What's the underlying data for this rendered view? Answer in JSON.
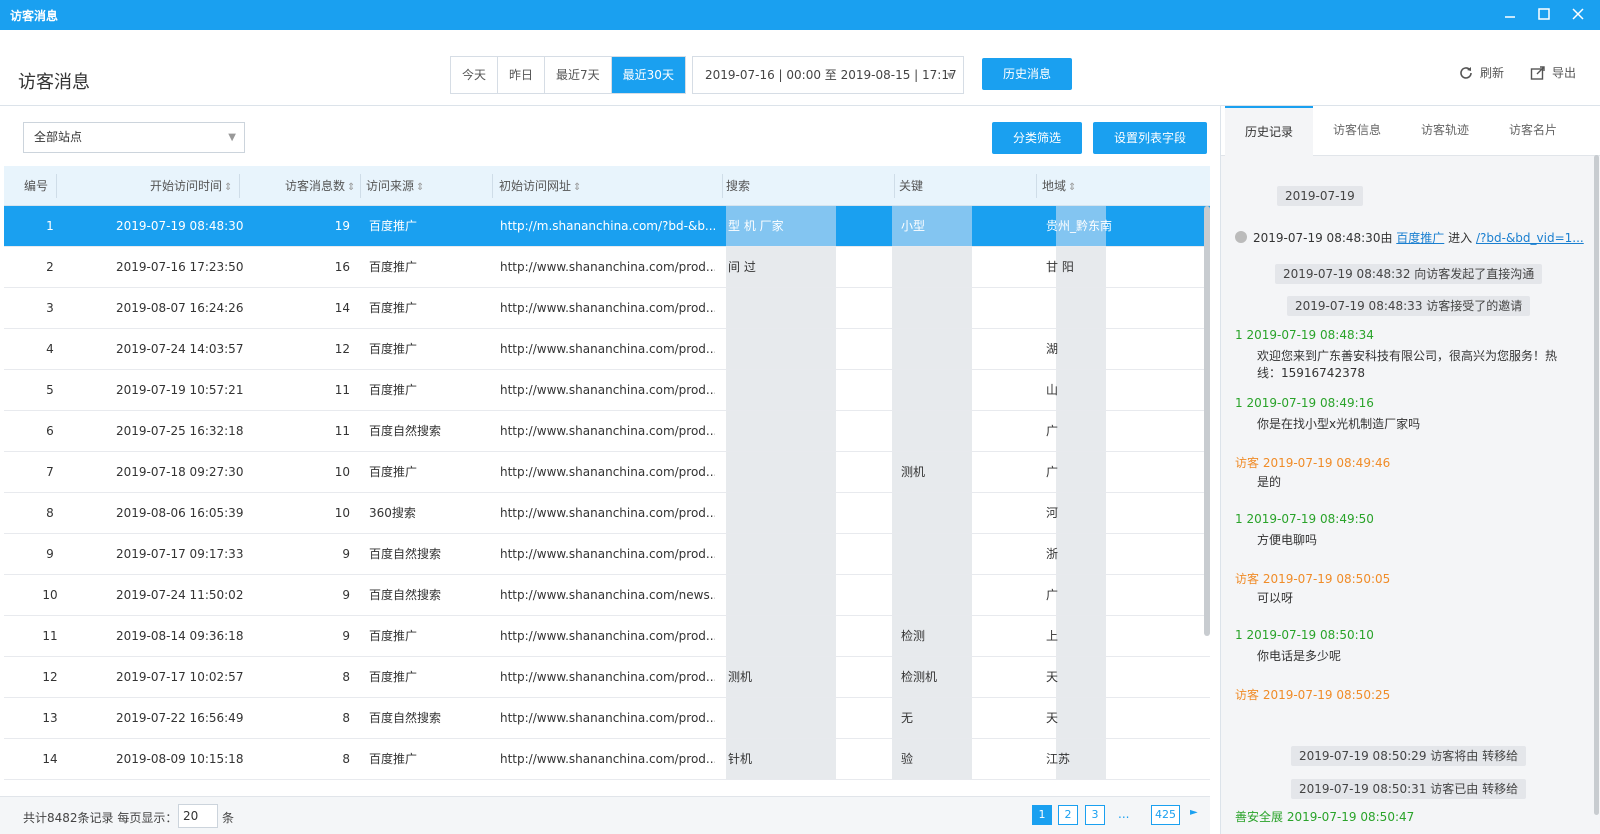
{
  "window": {
    "title": "访客消息"
  },
  "header": {
    "page_title": "访客消息",
    "range_tabs": [
      "今天",
      "昨日",
      "最近7天",
      "最近30天"
    ],
    "active_range": "最近30天",
    "date_range": "2019-07-16 | 00:00 至 2019-08-15 | 17:17",
    "history_button": "历史消息",
    "refresh_label": "刷新",
    "export_label": "导出"
  },
  "filters": {
    "site_select": "全部站点",
    "classify_button": "分类筛选",
    "columns_button": "设置列表字段"
  },
  "table": {
    "headers": {
      "num": "编号",
      "start_time": "开始访问时间",
      "msg_count": "访客消息数",
      "source": "访问来源",
      "url": "初始访问网址",
      "search": "搜索",
      "keyword": "关键",
      "region": "地域"
    },
    "rows": [
      {
        "num": "1",
        "time": "2019-07-19 08:48:30",
        "count": "19",
        "source": "百度推广",
        "url": "http://m.shananchina.com/?bd-&b...",
        "search": "型   机   厂家",
        "keyword": "小型",
        "region": "贵州_黔东南"
      },
      {
        "num": "2",
        "time": "2019-07-16 17:23:50",
        "count": "16",
        "source": "百度推广",
        "url": "http://www.shananchina.com/prod...",
        "search": "间  过",
        "keyword": "",
        "region": "甘   阳"
      },
      {
        "num": "3",
        "time": "2019-08-07 16:24:26",
        "count": "14",
        "source": "百度推广",
        "url": "http://www.shananchina.com/prod...",
        "search": "",
        "keyword": "",
        "region": ""
      },
      {
        "num": "4",
        "time": "2019-07-24 14:03:57",
        "count": "12",
        "source": "百度推广",
        "url": "http://www.shananchina.com/prod...",
        "search": "",
        "keyword": "",
        "region": "湖"
      },
      {
        "num": "5",
        "time": "2019-07-19 10:57:21",
        "count": "11",
        "source": "百度推广",
        "url": "http://www.shananchina.com/prod...",
        "search": "",
        "keyword": "",
        "region": "山"
      },
      {
        "num": "6",
        "time": "2019-07-25 16:32:18",
        "count": "11",
        "source": "百度自然搜索",
        "url": "http://www.shananchina.com/prod...",
        "search": "",
        "keyword": "",
        "region": "广"
      },
      {
        "num": "7",
        "time": "2019-07-18 09:27:30",
        "count": "10",
        "source": "百度推广",
        "url": "http://www.shananchina.com/prod...",
        "search": "",
        "keyword": "测机",
        "region": "广"
      },
      {
        "num": "8",
        "time": "2019-08-06 16:05:39",
        "count": "10",
        "source": "360搜索",
        "url": "http://www.shananchina.com/prod...",
        "search": "",
        "keyword": "",
        "region": "河"
      },
      {
        "num": "9",
        "time": "2019-07-17 09:17:33",
        "count": "9",
        "source": "百度自然搜索",
        "url": "http://www.shananchina.com/prod...",
        "search": "",
        "keyword": "",
        "region": "浙"
      },
      {
        "num": "10",
        "time": "2019-07-24 11:50:02",
        "count": "9",
        "source": "百度自然搜索",
        "url": "http://www.shananchina.com/news...",
        "search": "",
        "keyword": "",
        "region": "广"
      },
      {
        "num": "11",
        "time": "2019-08-14 09:36:18",
        "count": "9",
        "source": "百度推广",
        "url": "http://www.shananchina.com/prod...",
        "search": "",
        "keyword": "检测",
        "region": "上"
      },
      {
        "num": "12",
        "time": "2019-07-17 10:02:57",
        "count": "8",
        "source": "百度推广",
        "url": "http://www.shananchina.com/prod...",
        "search": "测机",
        "keyword": "检测机",
        "region": "天"
      },
      {
        "num": "13",
        "time": "2019-07-22 16:56:49",
        "count": "8",
        "source": "百度自然搜索",
        "url": "http://www.shananchina.com/prod...",
        "search": "",
        "keyword": "无",
        "region": "天"
      },
      {
        "num": "14",
        "time": "2019-08-09 10:15:18",
        "count": "8",
        "source": "百度推广",
        "url": "http://www.shananchina.com/prod...",
        "search": "针机",
        "keyword": "验",
        "region": "江苏"
      }
    ]
  },
  "footer": {
    "total_text": "共计8482条记录  每页显示：",
    "per_page": "20",
    "unit": "条",
    "pages": [
      "1",
      "2",
      "3"
    ],
    "ellipsis": "...",
    "last_page": "425",
    "next": "►"
  },
  "right_panel": {
    "tabs": [
      "历史记录",
      "访客信息",
      "访客轨迹",
      "访客名片"
    ],
    "date_pill": "2019-07-19",
    "entry_line": {
      "prefix": "2019-07-19 08:48:30由",
      "source": "百度推广",
      "mid": "进入",
      "link": "/?bd-&bd_vid=1..."
    },
    "events": [
      "2019-07-19 08:48:32 向访客发起了直接沟通",
      "2019-07-19 08:48:33 访客接受了的邀请"
    ],
    "messages": [
      {
        "role": "agent",
        "head": "1  2019-07-19 08:48:34",
        "body": "欢迎您来到广东善安科技有限公司，很高兴为您服务！热线：15916742378"
      },
      {
        "role": "agent",
        "head": "1  2019-07-19 08:49:16",
        "body": "你是在找小型x光机制造厂家吗"
      },
      {
        "role": "visitor",
        "head": "访客  2019-07-19 08:49:46",
        "body": "是的"
      },
      {
        "role": "agent",
        "head": "1  2019-07-19 08:49:50",
        "body": "方便电聊吗"
      },
      {
        "role": "visitor",
        "head": "访客  2019-07-19 08:50:05",
        "body": "可以呀"
      },
      {
        "role": "agent",
        "head": "1  2019-07-19 08:50:10",
        "body": "你电话是多少呢"
      },
      {
        "role": "visitor",
        "head": "访客  2019-07-19 08:50:25",
        "body": ""
      }
    ],
    "transfer_events": [
      "2019-07-19 08:50:29 访客将由 转移给",
      "2019-07-19 08:50:31 访客已由 转移给"
    ],
    "last_head": "善安全展  2019-07-19 08:50:47"
  },
  "colors": {
    "accent": "#1aa0f0",
    "agent": "#2aa32a",
    "visitor": "#f08c28"
  }
}
